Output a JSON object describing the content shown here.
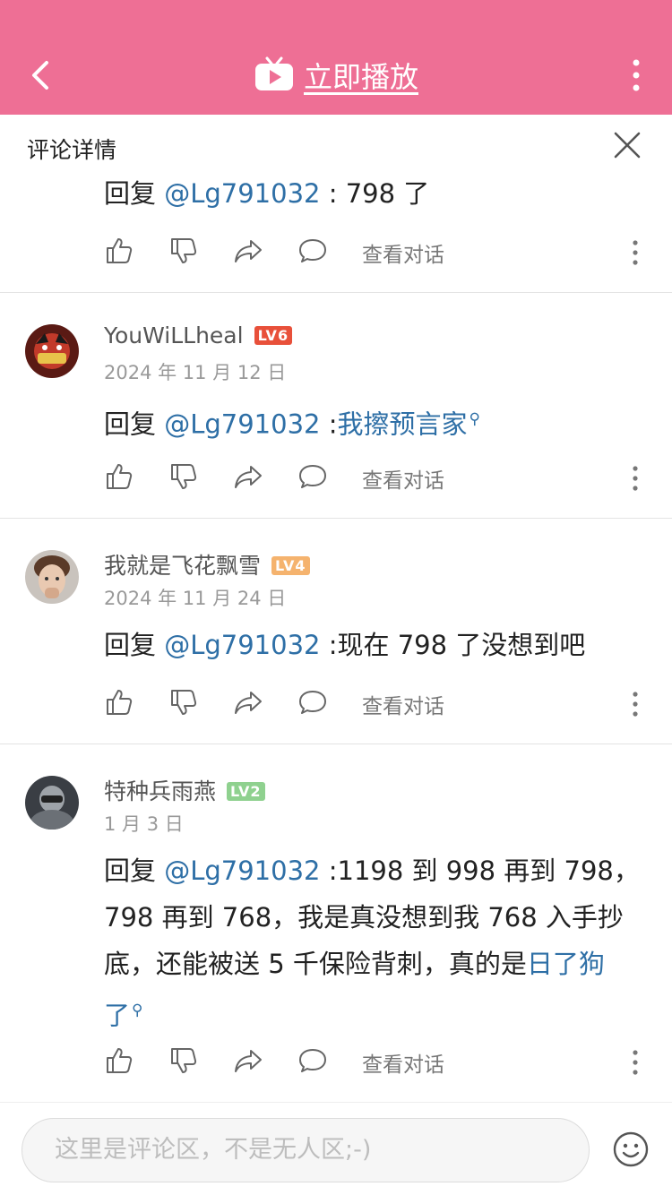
{
  "header": {
    "play_label": "立即播放",
    "bg_color": "#ee6f95"
  },
  "section": {
    "title": "评论详情"
  },
  "common": {
    "view_conversation": "查看对话",
    "reply_prefix": "回复 "
  },
  "comments": [
    {
      "mention": "@Lg791032",
      "text_plain": " : 798 了"
    },
    {
      "username": "YouWiLLheal",
      "level": "LV6",
      "level_color": "#e8503a",
      "date": "2024 年 11 月 12 日",
      "mention": "@Lg791032",
      "colon": " :",
      "link": "我擦预言家"
    },
    {
      "username": "我就是飞花飘雪",
      "level": "LV4",
      "level_color": "#f5b36e",
      "date": "2024 年 11 月 24 日",
      "mention": "@Lg791032",
      "text_plain": " :现在 798 了没想到吧"
    },
    {
      "username": "特种兵雨燕",
      "level": "LV2",
      "level_color": "#8fd18f",
      "date": "1 月 3 日",
      "mention": "@Lg791032",
      "line1_rest": " :1198 到 998 再到 798，",
      "line2": "798 再到 768，我是真没想到我 768 入手抄",
      "line3_plain": "底，还能被送 5 千保险背刺，真的是",
      "line3_link": "日了狗",
      "line4_link": "了"
    }
  ],
  "bottom": {
    "placeholder": "这里是评论区，不是无人区;-)"
  }
}
